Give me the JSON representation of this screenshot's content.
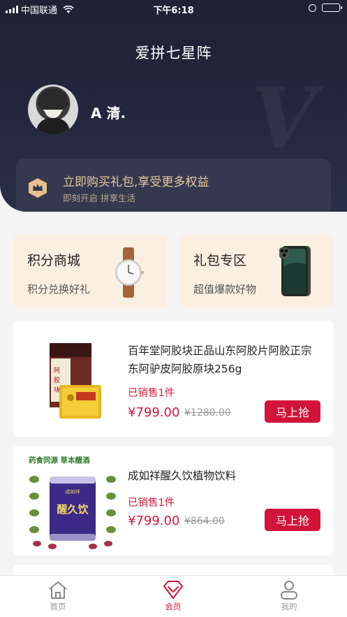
{
  "status_bar": {
    "carrier": "中国联通",
    "time": "下午6:18"
  },
  "header": {
    "title": "爱拼七星阵",
    "username": "A 清.",
    "watermark": "V"
  },
  "promo": {
    "title": "立即购买礼包,享受更多权益",
    "subtitle": "即刻开启 拼享生活",
    "color": "#e9c89e"
  },
  "categories": [
    {
      "title": "积分商城",
      "subtitle": "积分兑换好礼",
      "icon": "watch-icon"
    },
    {
      "title": "礼包专区",
      "subtitle": "超值爆款好物",
      "icon": "phone-icon"
    }
  ],
  "products": [
    {
      "name": "百年堂阿胶块正品山东阿胶片阿胶正宗东阿驴皮阿胶原块256g",
      "sold": "已销售1件",
      "price": "¥799.00",
      "old_price": "¥1280.00",
      "buy_label": "马上抢"
    },
    {
      "name": "成如祥醒久饮植物饮料",
      "sold": "已销售1件",
      "price": "¥799.00",
      "old_price": "¥864.00",
      "buy_label": "马上抢",
      "image_text": {
        "top": "药食同源 草本醒酒",
        "can": "醒久饮",
        "brand": "成如祥"
      }
    }
  ],
  "tabs": [
    {
      "label": "首页",
      "icon": "home-icon",
      "active": false
    },
    {
      "label": "会员",
      "icon": "diamond-icon",
      "active": true
    },
    {
      "label": "我的",
      "icon": "user-icon",
      "active": false
    }
  ],
  "colors": {
    "accent": "#d2143a",
    "header_bg": "#1f2233",
    "card_bg": "#fbefe2"
  }
}
